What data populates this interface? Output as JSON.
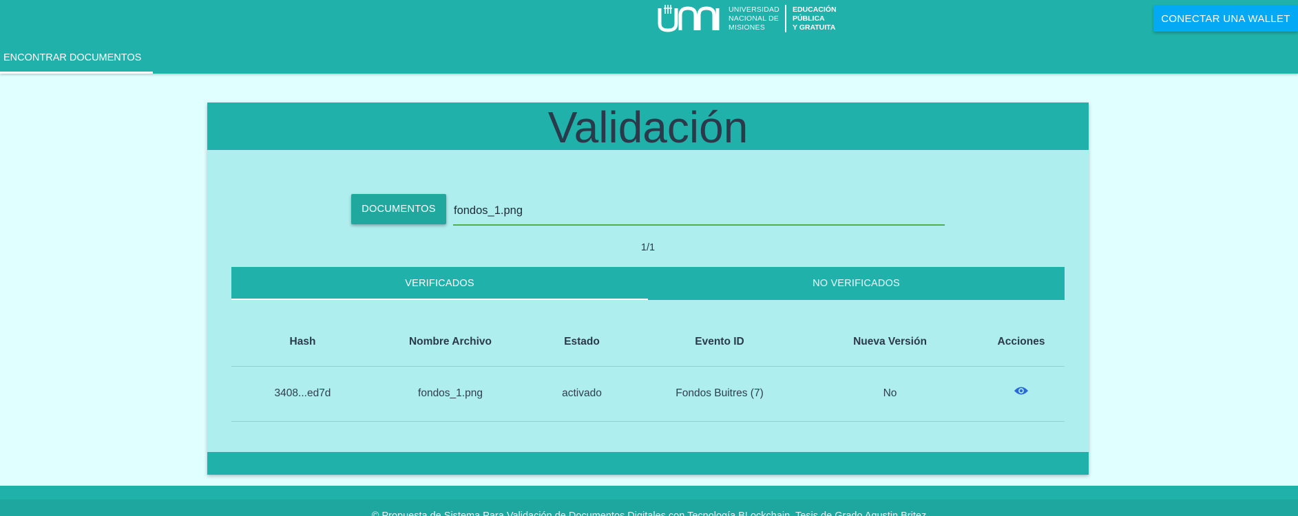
{
  "header": {
    "logo": {
      "line1": "UNIVERSIDAD",
      "line2": "NACIONAL DE",
      "line3": "MISIONES",
      "tag1": "EDUCACIÓN",
      "tag2": "PÚBLICA",
      "tag3": "Y GRATUITA"
    },
    "wallet_label": "CONECTAR UNA WALLET",
    "nav_tab_label": "ENCONTRAR DOCUMENTOS"
  },
  "card": {
    "title": "Validación",
    "documents_button": "DOCUMENTOS",
    "search_value": "fondos_1.png",
    "pager": "1/1",
    "tabs": [
      {
        "label": "VERIFICADOS"
      },
      {
        "label": "NO VERIFICADOS"
      }
    ],
    "table": {
      "headers": [
        "Hash",
        "Nombre Archivo",
        "Estado",
        "Evento ID",
        "Nueva Versión",
        "Acciones"
      ],
      "rows": [
        {
          "hash": "3408...ed7d",
          "file": "fondos_1.png",
          "status": "activado",
          "event": "Fondos Buitres (7)",
          "new_version": "No",
          "action_icon": "eye-icon"
        }
      ]
    }
  },
  "footer": {
    "text": "© Propuesta de Sistema Para Validación de Documentos Digitales con Tecnología BLockchain. Tesis de Grado Agustin Britez"
  },
  "colors": {
    "header_bg": "#20b2aa",
    "page_bg": "#e0ffff",
    "card_bg": "#afeeee",
    "wallet_button": "#03a9f4",
    "input_underline": "#4caf50",
    "eye_icon": "#2a6ad8"
  }
}
